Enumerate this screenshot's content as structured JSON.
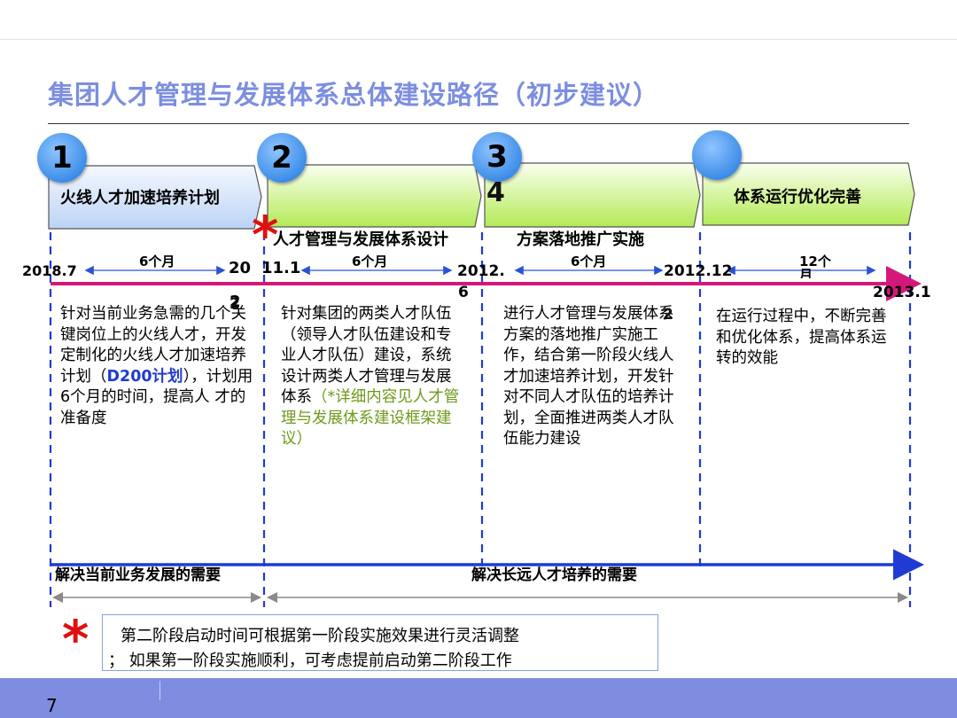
{
  "title": "集团人才管理与发展体系总体建设路径（初步建议）",
  "stages": [
    {
      "number": "1",
      "label": "火线人才加速培养计划"
    },
    {
      "number": "2",
      "label": "人才管理与发展体系设计"
    },
    {
      "number": "3",
      "number_extra": "4",
      "label": "方案落地推广实施"
    },
    {
      "number": "",
      "label": "体系运行优化完善"
    }
  ],
  "timeline": {
    "dates": [
      "2018.7",
      "20",
      "2",
      "11.1",
      "2012.",
      "6",
      "2012.12",
      "2013.1"
    ],
    "durations": [
      "6个月",
      "6个月",
      "6个月",
      "12个",
      "月"
    ]
  },
  "descriptions": {
    "d1_a": "针对当前业务急需的几个关键岗位上的火线人才，开发定制化的火线人才加速培养计划",
    "d1_b": "（",
    "d1_c": "D200计划",
    "d1_d": "），计划用  6个月的时间，提高人 才的准备度",
    "d1_extra": "2",
    "d2_a": "针对集团的两类人才队伍（领导人才队伍建设和专业人才队伍）建设，系统设计两类人才管理与发展体系",
    "d2_b": "（*详细内容见人才管理与发展体系建设框架建议）",
    "d3": "进行人才管理与发展体系方案的落地推广实施工作，结合第一阶段火线人才加速培养计划，开发针对不同人才队伍的培养计划，全面推进两类人才队伍能力建设",
    "d3_extra": "2",
    "d4": "在运行过程中，不断完善和优化体系，提高体系运转的效能"
  },
  "needs": [
    "解决当前业务发展的需要",
    "解决长远人才培养的需要"
  ],
  "note": {
    "star": "*",
    "line1": "第二阶段启动时间可根据第一阶段实施效果进行灵活调整",
    "line2": "；  如果第一阶段实施顺利，可考虑提前启动第二阶段工作"
  },
  "page_number": "7",
  "colors": {
    "title": "#7c8ee0",
    "timeline": "#d4187a",
    "need_arrow": "#1f3bd1",
    "footer": "#7e8de0",
    "star": "#e01010"
  }
}
